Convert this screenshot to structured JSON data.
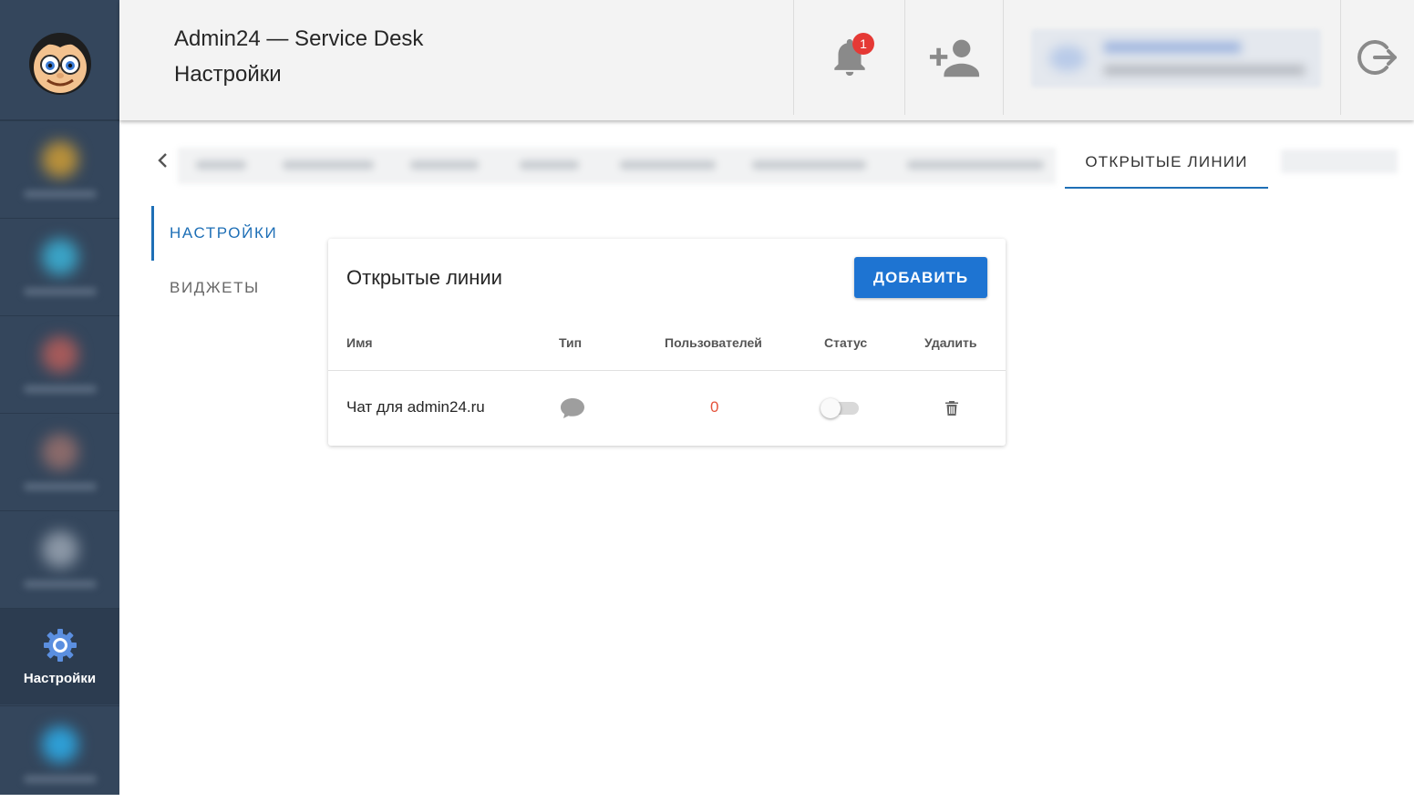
{
  "header": {
    "app_title": "Admin24 — Service Desk",
    "page_title": "Настройки",
    "notifications_count": "1"
  },
  "sidebar": {
    "active_item_label": "Настройки"
  },
  "tabs": {
    "active_label": "ОТКРЫТЫЕ ЛИНИИ"
  },
  "subnav": {
    "items": [
      {
        "label": "НАСТРОЙКИ",
        "active": true
      },
      {
        "label": "ВИДЖЕТЫ",
        "active": false
      }
    ]
  },
  "card": {
    "title": "Открытые линии",
    "add_button_label": "ДОБАВИТЬ",
    "columns": [
      "Имя",
      "Тип",
      "Пользователей",
      "Статус",
      "Удалить"
    ],
    "rows": [
      {
        "name": "Чат для admin24.ru",
        "type_icon": "chat-bubble-icon",
        "users": "0",
        "status_on": false
      }
    ]
  },
  "colors": {
    "sidebar_bg": "#34465c",
    "accent": "#1e6fb6",
    "button": "#1e74d2",
    "badge": "#e53935",
    "count": "#e5533b"
  }
}
